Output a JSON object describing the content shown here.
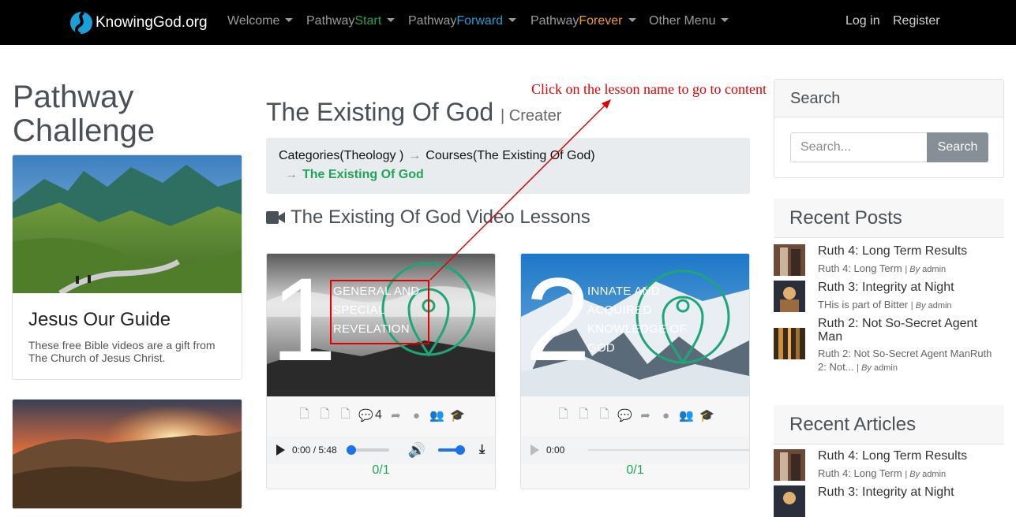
{
  "nav": {
    "brand": "KnowingGod.org",
    "items": [
      {
        "prefix": "Welcome",
        "accent": "",
        "accent_color": ""
      },
      {
        "prefix": "Pathway",
        "accent": "Start",
        "accent_color": "#1fa55a"
      },
      {
        "prefix": "Pathway",
        "accent": "Forward",
        "accent_color": "#1a9fd6"
      },
      {
        "prefix": "Pathway",
        "accent": "Forever",
        "accent_color": "#f0a020"
      },
      {
        "prefix": "Other Menu",
        "accent": "",
        "accent_color": ""
      }
    ],
    "login": "Log in",
    "register": "Register"
  },
  "sidebar": {
    "title": "Pathway Challenge",
    "card1": {
      "title": "Jesus Our Guide",
      "text": "These free Bible videos are a gift from The Church of Jesus Christ."
    }
  },
  "main": {
    "title": "The Existing Of God",
    "subtitle": "| Creater",
    "breadcrumb": {
      "category": "Categories(Theology )",
      "course": "Courses(The Existing Of God)",
      "current": "The Existing Of God",
      "separator": "→"
    },
    "section_title": "The Existing Of God Video Lessons",
    "lessons": [
      {
        "number": "1",
        "title": "GENERAL AND SPECIAL REVELATION",
        "comments": "4",
        "time": "0:00 / 5:48",
        "score": "0/1",
        "progress": 0
      },
      {
        "number": "2",
        "title": "INNATE AND ACQUIRED KNOWLEDGE OF GOD",
        "comments": "",
        "time": "0:00",
        "score": "0/1",
        "progress": 0
      }
    ],
    "annotation": "Click on the lesson name to go to content"
  },
  "search": {
    "title": "Search",
    "placeholder": "Search...",
    "button": "Search"
  },
  "recent_posts": {
    "title": "Recent Posts",
    "items": [
      {
        "title": "Ruth 4: Long Term Results",
        "sub": "Ruth 4: Long Term",
        "author": "admin"
      },
      {
        "title": "Ruth 3: Integrity at Night",
        "sub": "THis is part of Bitter",
        "author": "admin"
      },
      {
        "title": "Ruth 2: Not So-Secret Agent Man",
        "sub": "Ruth 2: Not So-Secret Agent ManRuth 2: Not...",
        "author": "admin"
      }
    ]
  },
  "recent_articles": {
    "title": "Recent Articles",
    "items": [
      {
        "title": "Ruth 4: Long Term Results",
        "sub": "Ruth 4: Long Term",
        "author": "admin"
      },
      {
        "title": "Ruth 3: Integrity at Night",
        "sub": "",
        "author": ""
      }
    ]
  },
  "by_label": "By",
  "colors": {
    "accent_green": "#1fa55a",
    "annotation_red": "#e00000",
    "navbar": "#000000"
  }
}
